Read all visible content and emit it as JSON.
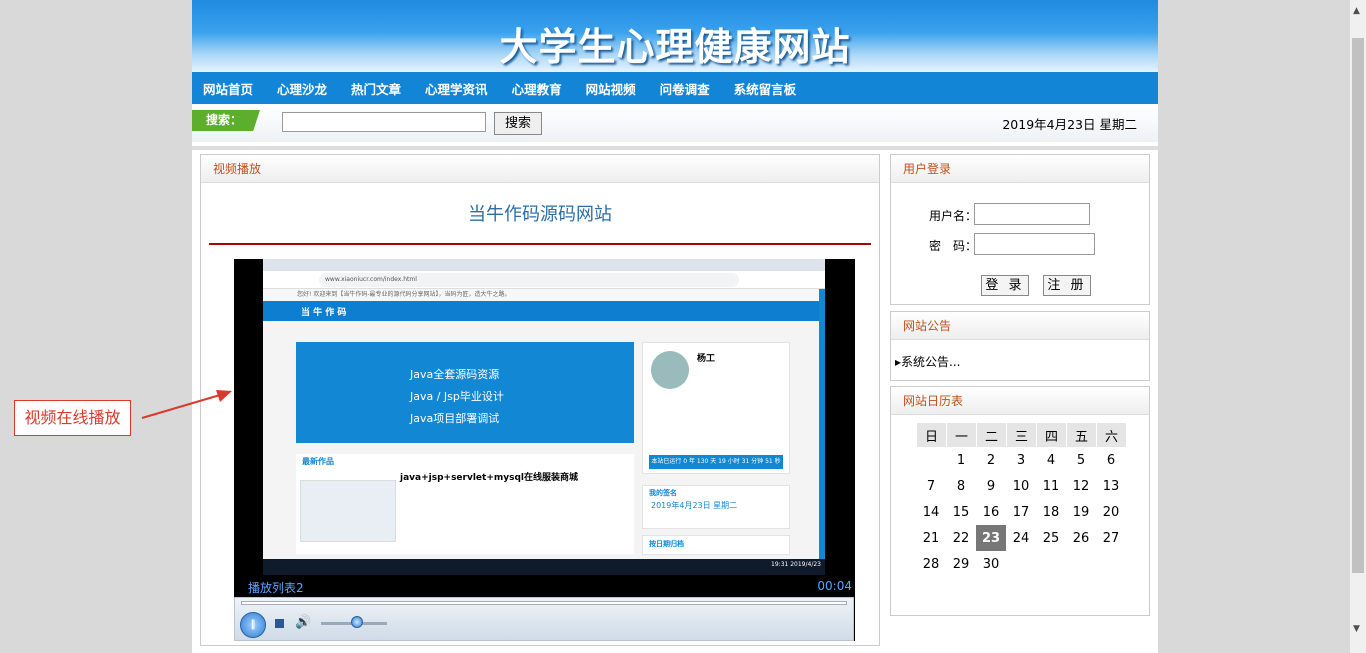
{
  "header": {
    "title": "大学生心理健康网站"
  },
  "nav": [
    "网站首页",
    "心理沙龙",
    "热门文章",
    "心理学资讯",
    "心理教育",
    "网站视频",
    "问卷调查",
    "系统留言板"
  ],
  "search": {
    "tag": "搜索：",
    "value": "",
    "button": "搜索"
  },
  "date": "2019年4月23日 星期二",
  "video_panel": {
    "heading": "视频播放",
    "title": "当牛作码源码网站",
    "player": {
      "playlist": "播放列表2",
      "time": "00:04",
      "progress": 0.0,
      "volume": 0.5,
      "screen": {
        "url": "www.xiaoniucr.com/index.html",
        "top_text": "您好! 欢迎来到【当牛作码-最专业的源代码分享网站】，当码为匠，造大牛之路。",
        "logo": "当 牛 作 码",
        "banner_lines": [
          "Java全套源码资源",
          "Java / Jsp毕业设计",
          "Java项目部署调试"
        ],
        "profile_name": "杨工",
        "runtime": "本站已运行 0 年 130 天 19 小时 31 分钟 51 秒",
        "works_heading": "最新作品",
        "works_item": "java+jsp+servlet+mysql在线服装商城",
        "sign_heading": "我的签名",
        "sign_date": "2019年4月23日 星期二",
        "archive": "按日期归档",
        "clock": "19:31 2019/4/23"
      }
    }
  },
  "annotation": {
    "text": "视频在线播放",
    "color": "#d83a2c"
  },
  "login": {
    "heading": "用户登录",
    "username_label": "用户名：",
    "password_label": "密　码：",
    "login_button": "登 录",
    "register_button": "注 册"
  },
  "notice": {
    "heading": "网站公告",
    "item": "系统公告..."
  },
  "calendar": {
    "heading": "网站日历表",
    "weekdays": [
      "日",
      "一",
      "二",
      "三",
      "四",
      "五",
      "六"
    ],
    "weeks": [
      [
        "",
        "1",
        "2",
        "3",
        "4",
        "5",
        "6"
      ],
      [
        "7",
        "8",
        "9",
        "10",
        "11",
        "12",
        "13"
      ],
      [
        "14",
        "15",
        "16",
        "17",
        "18",
        "19",
        "20"
      ],
      [
        "21",
        "22",
        "23",
        "24",
        "25",
        "26",
        "27"
      ],
      [
        "28",
        "29",
        "30",
        "",
        "",
        "",
        ""
      ]
    ],
    "today": "23"
  },
  "colors": {
    "nav": "#1285d6",
    "heading": "#c0501b",
    "accent_line": "#b00000"
  }
}
